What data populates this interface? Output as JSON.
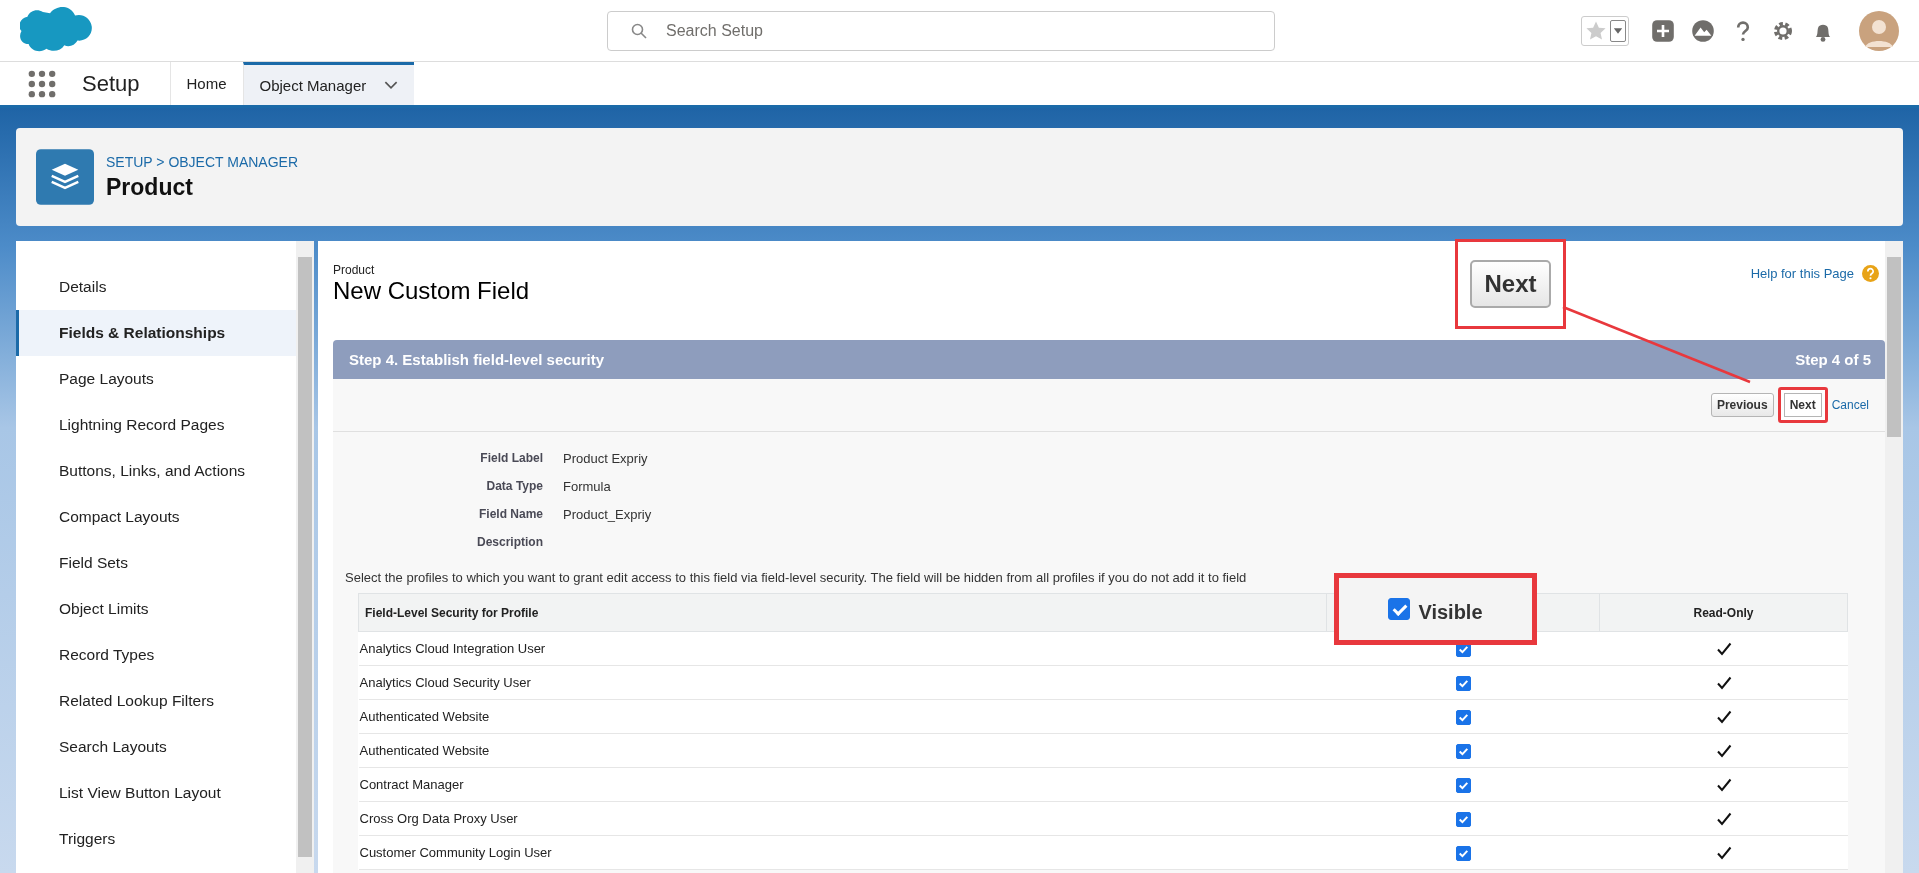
{
  "header": {
    "search": {
      "placeholder": "Search Setup"
    }
  },
  "nav": {
    "app_name": "Setup",
    "tabs": [
      {
        "label": "Home",
        "selected": false,
        "dropdown": false
      },
      {
        "label": "Object Manager",
        "selected": true,
        "dropdown": true
      }
    ]
  },
  "object_header": {
    "breadcrumb": "SETUP > OBJECT MANAGER",
    "title": "Product"
  },
  "sidebar": {
    "items": [
      {
        "label": "Details",
        "selected": false
      },
      {
        "label": "Fields & Relationships",
        "selected": true
      },
      {
        "label": "Page Layouts",
        "selected": false
      },
      {
        "label": "Lightning Record Pages",
        "selected": false
      },
      {
        "label": "Buttons, Links, and Actions",
        "selected": false
      },
      {
        "label": "Compact Layouts",
        "selected": false
      },
      {
        "label": "Field Sets",
        "selected": false
      },
      {
        "label": "Object Limits",
        "selected": false
      },
      {
        "label": "Record Types",
        "selected": false
      },
      {
        "label": "Related Lookup Filters",
        "selected": false
      },
      {
        "label": "Search Layouts",
        "selected": false
      },
      {
        "label": "List View Button Layout",
        "selected": false
      },
      {
        "label": "Triggers",
        "selected": false
      }
    ]
  },
  "page": {
    "object": "Product",
    "title": "New Custom Field",
    "help_link": "Help for this Page",
    "step": {
      "title": "Step 4. Establish field-level security",
      "counter": "Step 4 of 5"
    },
    "buttons": [
      {
        "label": "Previous",
        "kind": "button",
        "highlighted": false
      },
      {
        "label": "Next",
        "kind": "button",
        "highlighted": true
      },
      {
        "label": "Cancel",
        "kind": "link",
        "highlighted": false
      }
    ],
    "fields": [
      {
        "label": "Field Label",
        "value": "Product Expriy"
      },
      {
        "label": "Data Type",
        "value": "Formula"
      },
      {
        "label": "Field Name",
        "value": "Product_Expriy"
      },
      {
        "label": "Description"
      }
    ],
    "instructions": "Select the profiles to which you want to grant edit access to this field via field-level security. The field will be hidden from all profiles if you do not add it to field",
    "table": {
      "profile_header": "Field-Level Security for Profile",
      "read_only_header": "Read-Only",
      "rows": [
        {
          "profile": "Analytics Cloud Integration User",
          "visible": true,
          "read_only": true
        },
        {
          "profile": "Analytics Cloud Security User",
          "visible": true,
          "read_only": true
        },
        {
          "profile": "Authenticated Website",
          "visible": true,
          "read_only": true
        },
        {
          "profile": "Authenticated Website",
          "visible": true,
          "read_only": true
        },
        {
          "profile": "Contract Manager",
          "visible": true,
          "read_only": true
        },
        {
          "profile": "Cross Org Data Proxy User",
          "visible": true,
          "read_only": true
        },
        {
          "profile": "Customer Community Login User",
          "visible": true,
          "read_only": true
        }
      ]
    }
  },
  "annotations": [
    {
      "kind": "button",
      "label": "Next"
    },
    {
      "kind": "checkbox",
      "label": "Visible",
      "checked": true
    }
  ]
}
